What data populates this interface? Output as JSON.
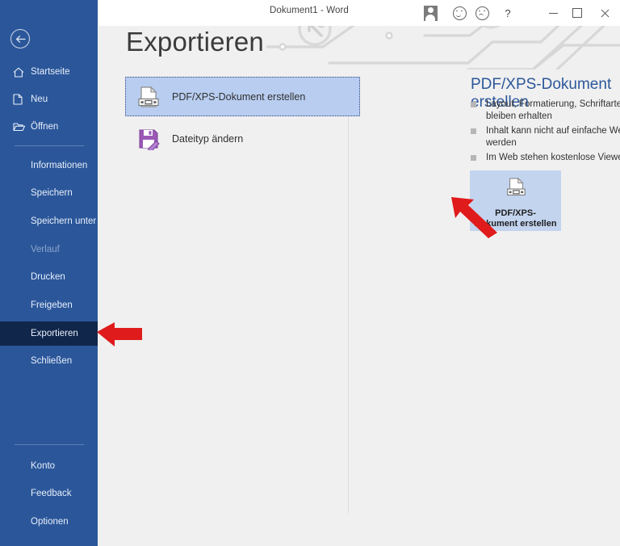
{
  "window": {
    "title": "Dokument1  -  Word",
    "controls": [
      {
        "name": "account-icon",
        "label": ""
      },
      {
        "name": "feedback-smile-icon",
        "label": ""
      },
      {
        "name": "feedback-frown-icon",
        "label": ""
      },
      {
        "name": "help-icon",
        "label": "?"
      },
      {
        "name": "minimize-button",
        "label": ""
      },
      {
        "name": "maximize-button",
        "label": ""
      },
      {
        "name": "close-button",
        "label": ""
      }
    ]
  },
  "sidebar": {
    "back_label": "",
    "background_color": "#2b579a",
    "active_color": "#10264b",
    "top_items": [
      {
        "label": "Startseite",
        "icon": "home-icon",
        "id": "startseite"
      },
      {
        "label": "Neu",
        "icon": "page-icon",
        "id": "neu"
      },
      {
        "label": "Öffnen",
        "icon": "folder-open-icon",
        "id": "oeffnen"
      }
    ],
    "middle_items": [
      {
        "label": "Informationen",
        "id": "informationen",
        "state": "normal"
      },
      {
        "label": "Speichern",
        "id": "speichern",
        "state": "normal"
      },
      {
        "label": "Speichern unter",
        "id": "speichern-unter",
        "state": "normal"
      },
      {
        "label": "Verlauf",
        "id": "verlauf",
        "state": "disabled"
      },
      {
        "label": "Drucken",
        "id": "drucken",
        "state": "normal"
      },
      {
        "label": "Freigeben",
        "id": "freigeben",
        "state": "normal"
      },
      {
        "label": "Exportieren",
        "id": "exportieren",
        "state": "active"
      },
      {
        "label": "Schließen",
        "id": "schliessen",
        "state": "normal"
      }
    ],
    "bottom_items": [
      {
        "label": "Konto",
        "id": "konto"
      },
      {
        "label": "Feedback",
        "id": "feedback"
      },
      {
        "label": "Optionen",
        "id": "optionen"
      }
    ]
  },
  "main": {
    "page_title": "Exportieren",
    "commands": [
      {
        "label": "PDF/XPS-Dokument erstellen",
        "icon": "pdf-document-icon",
        "selected": true
      },
      {
        "label": "Dateityp ändern",
        "icon": "floppy-pencil-icon",
        "selected": false
      }
    ],
    "detail": {
      "title": "PDF/XPS-Dokument erstellen",
      "bullets": [
        "Layout, Formatierung, Schriftarten und Bilder bleiben erhalten",
        "Inhalt kann nicht auf einfache Weise geändert werden",
        "Im Web stehen kostenlose Viewer zur Verfügung"
      ],
      "create_button": {
        "line1": "PDF/XPS-",
        "line2": "Dokument erstellen",
        "icon": "pdf-document-icon",
        "background_color": "#c3d4ef"
      }
    }
  },
  "annotations": {
    "arrow_color": "#e01b1b",
    "arrows": [
      {
        "name": "annotation-arrow-exportieren",
        "points_to": "Exportieren"
      },
      {
        "name": "annotation-arrow-create-button",
        "points_to": "PDF/XPS-Dokument erstellen"
      }
    ]
  }
}
